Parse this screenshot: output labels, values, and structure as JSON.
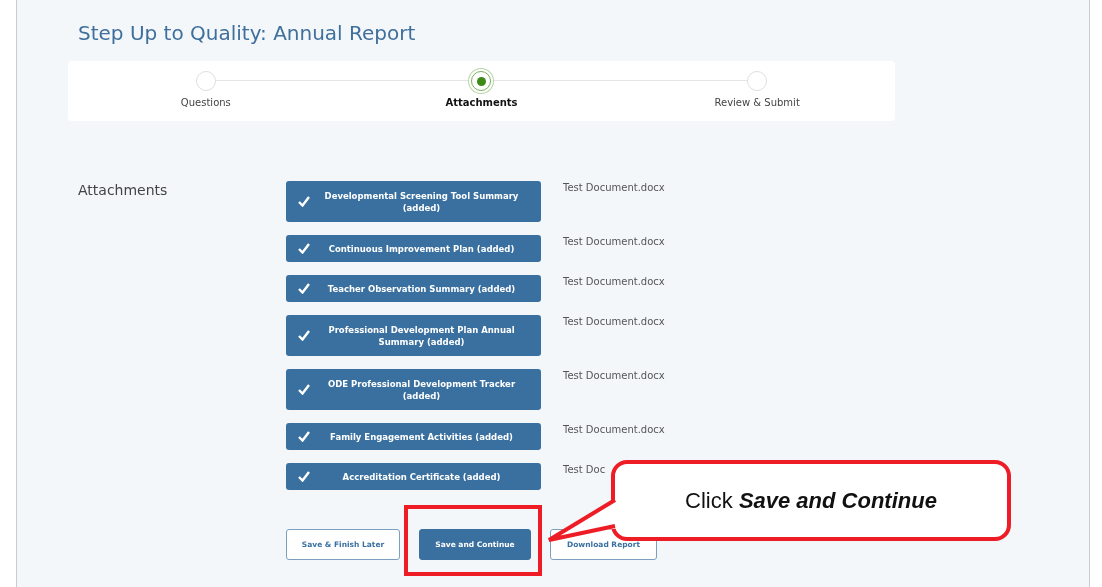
{
  "title": "Step Up to Quality: Annual Report",
  "steps": [
    {
      "label": "Questions",
      "selected": false
    },
    {
      "label": "Attachments",
      "selected": true
    },
    {
      "label": "Review & Submit",
      "selected": false
    }
  ],
  "section_label": "Attachments",
  "attachments": [
    {
      "label": "Developmental Screening Tool Summary (added)",
      "file": "Test Document.docx"
    },
    {
      "label": "Continuous Improvement Plan (added)",
      "file": "Test Document.docx"
    },
    {
      "label": "Teacher Observation Summary (added)",
      "file": "Test Document.docx"
    },
    {
      "label": "Professional Development Plan Annual Summary (added)",
      "file": "Test Document.docx"
    },
    {
      "label": "ODE Professional Development Tracker (added)",
      "file": "Test Document.docx"
    },
    {
      "label": "Family Engagement Activities (added)",
      "file": "Test Document.docx"
    },
    {
      "label": "Accreditation Certificate (added)",
      "file": "Test Doc"
    }
  ],
  "buttons": [
    {
      "label": "Save & Finish Later",
      "kind": "secondary",
      "highlighted": false
    },
    {
      "label": "Save and Continue",
      "kind": "primary",
      "highlighted": true
    },
    {
      "label": "Download Report",
      "kind": "secondary",
      "highlighted": false
    }
  ],
  "callout": {
    "prefix": "Click",
    "emphasis": "Save and Continue"
  }
}
